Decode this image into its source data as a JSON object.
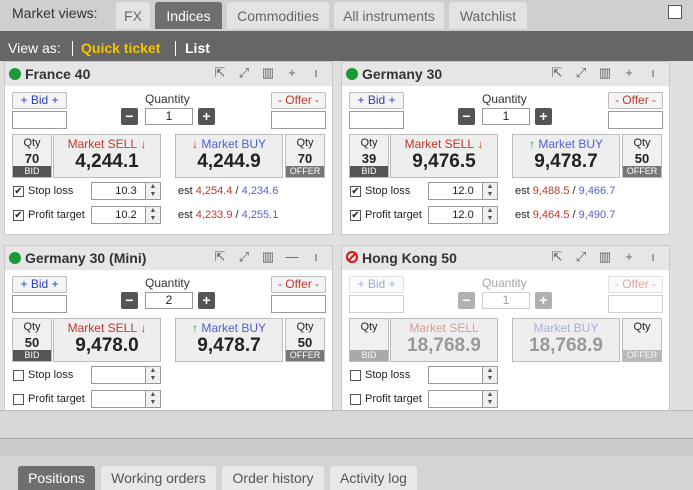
{
  "topbar": {
    "label": "Market views:",
    "tabs": [
      {
        "label": "FX",
        "active": false
      },
      {
        "label": "Indices",
        "active": true
      },
      {
        "label": "Commodities",
        "active": false
      },
      {
        "label": "All instruments",
        "active": false
      },
      {
        "label": "Watchlist",
        "active": false
      }
    ]
  },
  "viewbar": {
    "label": "View as:",
    "quick_ticket": "Quick ticket",
    "list": "List"
  },
  "common": {
    "bid": "+ Bid +",
    "offer": "- Offer -",
    "quantity": "Quantity",
    "qty": "Qty",
    "bid_tag": "BID",
    "offer_tag": "OFFER",
    "market_sell": "Market SELL",
    "market_buy": "Market BUY",
    "stop_loss": "Stop loss",
    "profit_target": "Profit target",
    "est": "est",
    "slash": "/"
  },
  "panels": [
    {
      "title": "France 40",
      "status": "open",
      "quantity": "1",
      "sell_qty": "70",
      "buy_qty": "70",
      "sell_price": "4,244.1",
      "buy_price": "4,244.9",
      "stop_loss": {
        "checked": true,
        "value": "10.3",
        "est_sell": "4,254.4",
        "est_buy": "4,234.6"
      },
      "profit_target": {
        "checked": true,
        "value": "10.2",
        "est_sell": "4,233.9",
        "est_buy": "4,255.1"
      }
    },
    {
      "title": "Germany 30",
      "status": "open",
      "quantity": "1",
      "sell_qty": "39",
      "buy_qty": "50",
      "sell_price": "9,476.5",
      "buy_price": "9,478.7",
      "stop_loss": {
        "checked": true,
        "value": "12.0",
        "est_sell": "9,488.5",
        "est_buy": "9,466.7"
      },
      "profit_target": {
        "checked": true,
        "value": "12.0",
        "est_sell": "9,464.5",
        "est_buy": "9,490.7"
      }
    },
    {
      "title": "Germany 30 (Mini)",
      "status": "open",
      "quantity": "2",
      "sell_qty": "50",
      "buy_qty": "50",
      "sell_price": "9,478.0",
      "buy_price": "9,478.7",
      "stop_loss": {
        "checked": false,
        "value": ""
      },
      "profit_target": {
        "checked": false,
        "value": ""
      }
    },
    {
      "title": "Hong Kong 50",
      "status": "closed",
      "quantity": "1",
      "sell_qty": "",
      "buy_qty": "",
      "sell_price": "18,768.9",
      "buy_price": "18,768.9",
      "stop_loss": {
        "checked": false,
        "value": ""
      },
      "profit_target": {
        "checked": false,
        "value": ""
      }
    }
  ],
  "bottom_tabs": [
    {
      "label": "Positions",
      "active": true
    },
    {
      "label": "Working orders",
      "active": false
    },
    {
      "label": "Order history",
      "active": false
    },
    {
      "label": "Activity log",
      "active": false
    }
  ]
}
